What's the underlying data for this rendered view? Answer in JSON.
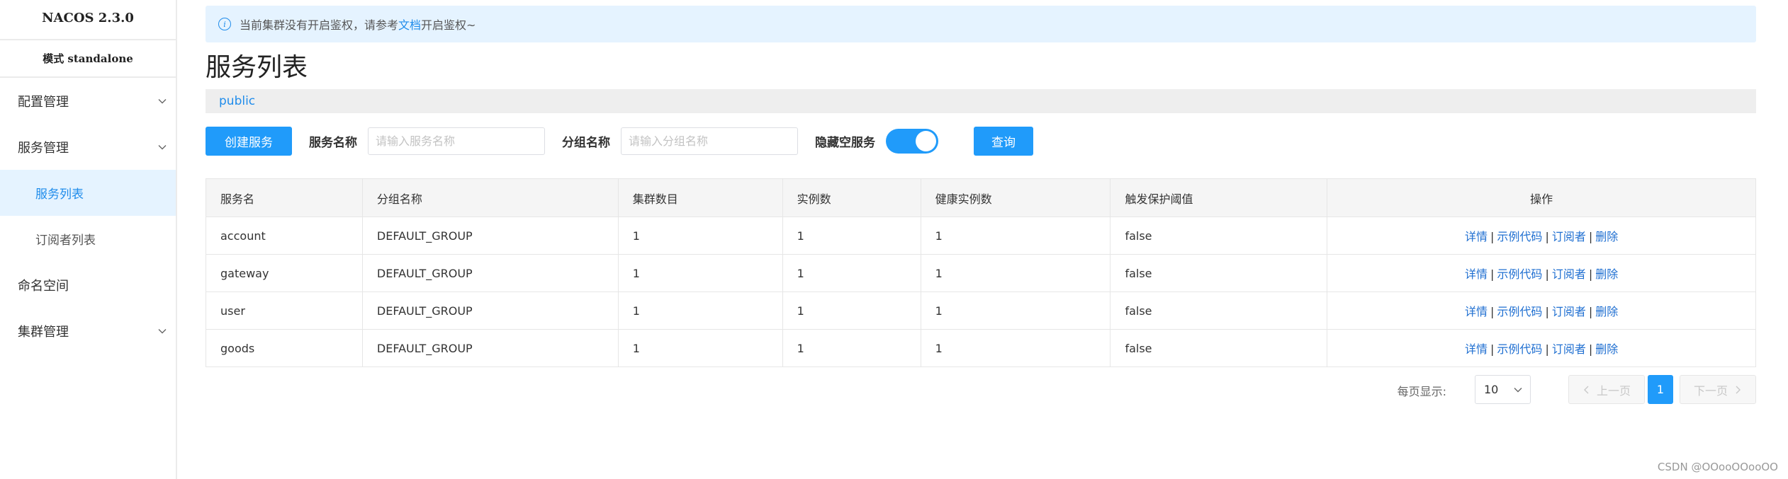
{
  "sidebar": {
    "brand": "NACOS 2.3.0",
    "mode": "模式 standalone",
    "items": [
      {
        "label": "配置管理",
        "icon": "chevron-down-icon"
      },
      {
        "label": "服务管理",
        "icon": "chevron-down-icon"
      },
      {
        "label": "服务列表",
        "active": true
      },
      {
        "label": "订阅者列表"
      },
      {
        "label": "命名空间"
      },
      {
        "label": "集群管理",
        "icon": "chevron-down-icon"
      }
    ]
  },
  "notice": {
    "prefix": "当前集群没有开启鉴权，请参考",
    "link": "文档",
    "suffix": "开启鉴权~"
  },
  "page": {
    "title": "服务列表",
    "namespace": "public"
  },
  "filters": {
    "create_button": "创建服务",
    "service_name_label": "服务名称",
    "service_name_placeholder": "请输入服务名称",
    "group_name_label": "分组名称",
    "group_name_placeholder": "请输入分组名称",
    "hide_empty_label": "隐藏空服务",
    "hide_empty_on": true,
    "query_button": "查询"
  },
  "table": {
    "headers": [
      "服务名",
      "分组名称",
      "集群数目",
      "实例数",
      "健康实例数",
      "触发保护阈值",
      "操作"
    ],
    "rows": [
      [
        "account",
        "DEFAULT_GROUP",
        "1",
        "1",
        "1",
        "false"
      ],
      [
        "gateway",
        "DEFAULT_GROUP",
        "1",
        "1",
        "1",
        "false"
      ],
      [
        "user",
        "DEFAULT_GROUP",
        "1",
        "1",
        "1",
        "false"
      ],
      [
        "goods",
        "DEFAULT_GROUP",
        "1",
        "1",
        "1",
        "false"
      ]
    ],
    "actions": {
      "detail": "详情",
      "sample_code": "示例代码",
      "subscribers": "订阅者",
      "delete": "删除",
      "separator": "|"
    }
  },
  "pagination": {
    "page_size_label": "每页显示:",
    "page_size": "10",
    "prev": "上一页",
    "current_page": "1",
    "next": "下一页"
  },
  "watermark": "CSDN @OOooOOooOO",
  "colors": {
    "primary": "#209bfa",
    "link": "#1f6fd1",
    "notice_bg": "#e5f3ff"
  }
}
